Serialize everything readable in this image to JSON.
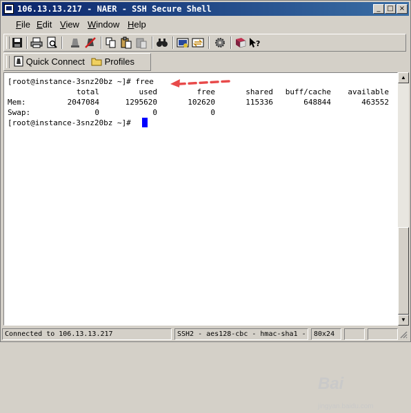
{
  "window": {
    "title": "106.13.13.217 - NAER - SSH Secure Shell"
  },
  "title_buttons": {
    "minimize": "_",
    "maximize": "□",
    "close": "×"
  },
  "menu": [
    {
      "hot": "F",
      "rest": "ile"
    },
    {
      "hot": "E",
      "rest": "dit"
    },
    {
      "hot": "V",
      "rest": "iew"
    },
    {
      "hot": "W",
      "rest": "indow"
    },
    {
      "hot": "H",
      "rest": "elp"
    }
  ],
  "toolbar2": {
    "quick_connect": "Quick Connect",
    "profiles": "Profiles"
  },
  "terminal": {
    "prompt1": "[root@instance-3snz20bz ~]# free",
    "prompt2": "[root@instance-3snz20bz ~]# ",
    "headers": [
      "total",
      "used",
      "free",
      "shared",
      "buff/cache",
      "available"
    ],
    "rows": [
      {
        "label": "Mem:",
        "values": [
          "2047084",
          "1295620",
          "102620",
          "115336",
          "648844",
          "463552"
        ]
      },
      {
        "label": "Swap:",
        "values": [
          "0",
          "0",
          "0",
          "",
          "",
          ""
        ]
      }
    ]
  },
  "status": {
    "connection": "Connected to 106.13.13.217",
    "cipher": "SSH2 - aes128-cbc - hmac-sha1 - ",
    "size": "80x24"
  },
  "watermark": {
    "main": "Bai",
    "sub": "jingyan.baidu.com"
  },
  "colors": {
    "arrow": "#e84a4a",
    "cursor": "#0000ff",
    "title_start": "#0a246a",
    "title_end": "#3a6ea5"
  }
}
